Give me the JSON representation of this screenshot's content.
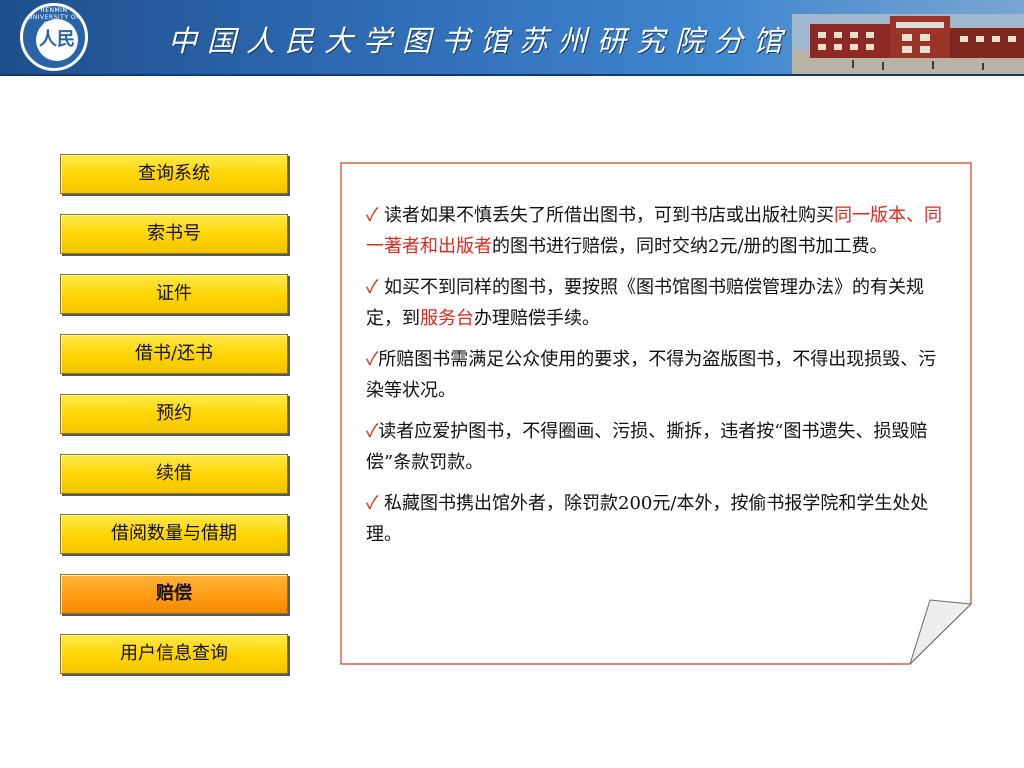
{
  "header": {
    "title": "中国人民大学图书馆苏州研究院分馆",
    "logo_text": "人民",
    "logo_ring": "RENMIN UNIVERSITY OF CHINA"
  },
  "menu": {
    "items": [
      {
        "label": "查询系统"
      },
      {
        "label": "索书号"
      },
      {
        "label": "证件"
      },
      {
        "label": "借书/还书"
      },
      {
        "label": "预约"
      },
      {
        "label": "续借"
      },
      {
        "label": "借阅数量与借期"
      },
      {
        "label": "赔偿",
        "active": true
      },
      {
        "label": "用户信息查询"
      }
    ]
  },
  "content": {
    "check_mark": "✓",
    "p1_a": " 读者如果不慎丢失了所借出图书，可到书店或出版社购买",
    "p1_red": "同一版本、同一著者和出版者",
    "p1_b": "的图书进行赔偿，同时交纳2元/册的图书加工费。",
    "p2_a": " 如买不到同样的图书，要按照《图书馆图书赔偿管理办法》的有关规定，到",
    "p2_red": "服务台",
    "p2_b": "办理赔偿手续。",
    "p3": "所赔图书需满足公众使用的要求，不得为盗版图书，不得出现损毁、污染等状况。",
    "p4": "读者应爱护图书，不得圈画、污损、撕拆，违者按“图书遗失、损毁赔偿”条款罚款。",
    "p5": " 私藏图书携出馆外者，除罚款200元/本外，按偷书报学院和学生处处理。"
  },
  "colors": {
    "banner": "#2e6bb3",
    "menu_yellow": "#ffd400",
    "menu_active": "#ff9a12",
    "note_border": "#d0401c",
    "highlight": "#e0281e"
  }
}
